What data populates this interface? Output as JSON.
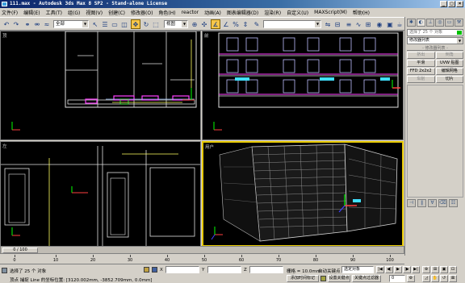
{
  "window": {
    "title": "111.max - Autodesk 3ds Max 8 SP2  - Stand-alone License",
    "min": "_",
    "max": "□",
    "close": "×"
  },
  "menu": [
    "文件(F)",
    "编辑(E)",
    "工具(T)",
    "组(G)",
    "视图(V)",
    "创建(C)",
    "修改器(O)",
    "角色(H)",
    "reactor",
    "动画(A)",
    "图表编辑器(D)",
    "渲染(R)",
    "自定义(U)",
    "MAXScript(M)",
    "帮助(H)"
  ],
  "toolbar": {
    "selection_filter": "全部",
    "ref_coord": "视图",
    "named_selection": "",
    "right_combo": "视图"
  },
  "viewports": {
    "top": "顶",
    "front": "前",
    "left": "左",
    "perspective": "用户"
  },
  "command_panel": {
    "object_name": "选择了 25 个 对象",
    "modifier_list": "修改器列表",
    "header": "- 修改器列表 -",
    "buttons": [
      [
        "挤出",
        "倒角"
      ],
      [
        "平滑",
        "UVW 贴图"
      ],
      [
        "FFD 2x2x2",
        "编辑网格"
      ],
      [
        "车削",
        "切片"
      ]
    ]
  },
  "timeline": {
    "frame": "0 / 100",
    "ticks": [
      "0",
      "10",
      "20",
      "30",
      "40",
      "50",
      "60",
      "70",
      "80",
      "90",
      "100"
    ]
  },
  "status": {
    "selected": "选择了 25 个 对象",
    "prompt": "顶点 捕捉 Line 的坐标位置: [3120.002mm, -3852.709mm, 0.0mm]",
    "x_label": "X",
    "y_label": "Y",
    "z_label": "Z",
    "x_value": "",
    "y_value": "",
    "z_value": "",
    "grid": "栅格 = 10.0mm",
    "auto_key": "自动关键点",
    "selected_object": "选定对象",
    "set_key": "设置关键点",
    "key_filters": "关键点过滤器",
    "add_time_tag": "添加时间标记",
    "frame_value": "0"
  }
}
